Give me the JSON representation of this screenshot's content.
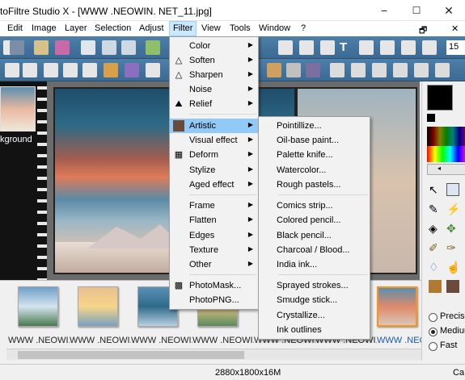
{
  "window": {
    "title": "toFiltre Studio X - [WWW .NEOWIN. NET_11.jpg]",
    "minimize": "−",
    "maximize": "☐",
    "close": "✕"
  },
  "menubar": {
    "restore_glyph": "🗗",
    "close_glyph": "✕",
    "items": [
      "Edit",
      "Image",
      "Layer",
      "Selection",
      "Adjust",
      "Filter",
      "View",
      "Tools",
      "Window",
      "?"
    ]
  },
  "toolbar": {
    "zoom": "15"
  },
  "left_panel": {
    "layer_label": "kground"
  },
  "filter_menu": {
    "items": [
      "Color",
      "Soften",
      "Sharpen",
      "Noise",
      "Relief",
      "Artistic",
      "Visual effect",
      "Deform",
      "Stylize",
      "Aged effect",
      "Frame",
      "Flatten",
      "Edges",
      "Texture",
      "Other",
      "PhotoMask...",
      "PhotoPNG..."
    ]
  },
  "artistic_submenu": {
    "items": [
      "Pointillize...",
      "Oil-base paint...",
      "Palette knife...",
      "Watercolor...",
      "Rough pastels...",
      "Comics strip...",
      "Colored pencil...",
      "Black pencil...",
      "Charcoal / Blood...",
      "India ink...",
      "Sprayed strokes...",
      "Smudge stick...",
      "Crystallize...",
      "Ink outlines"
    ]
  },
  "thumbnails": {
    "labels": [
      "WWW .NEOWI...",
      "WWW .NEOWI...",
      "WWW .NEOWI...",
      "WWW .NEOWI...",
      "WWW .NEOWI...",
      "WWW .NEOWI...",
      "WWW .NEOWI..."
    ]
  },
  "right_panel": {
    "options": [
      "Precise",
      "Medium",
      "Fast"
    ],
    "selected": "Medium"
  },
  "status": {
    "dimensions": "2880x1800x16M",
    "right": "Ca"
  },
  "colors": {
    "toolbar": "#3f6e96",
    "highlight": "#91c9f7",
    "active_menu": "#cce8ff"
  }
}
